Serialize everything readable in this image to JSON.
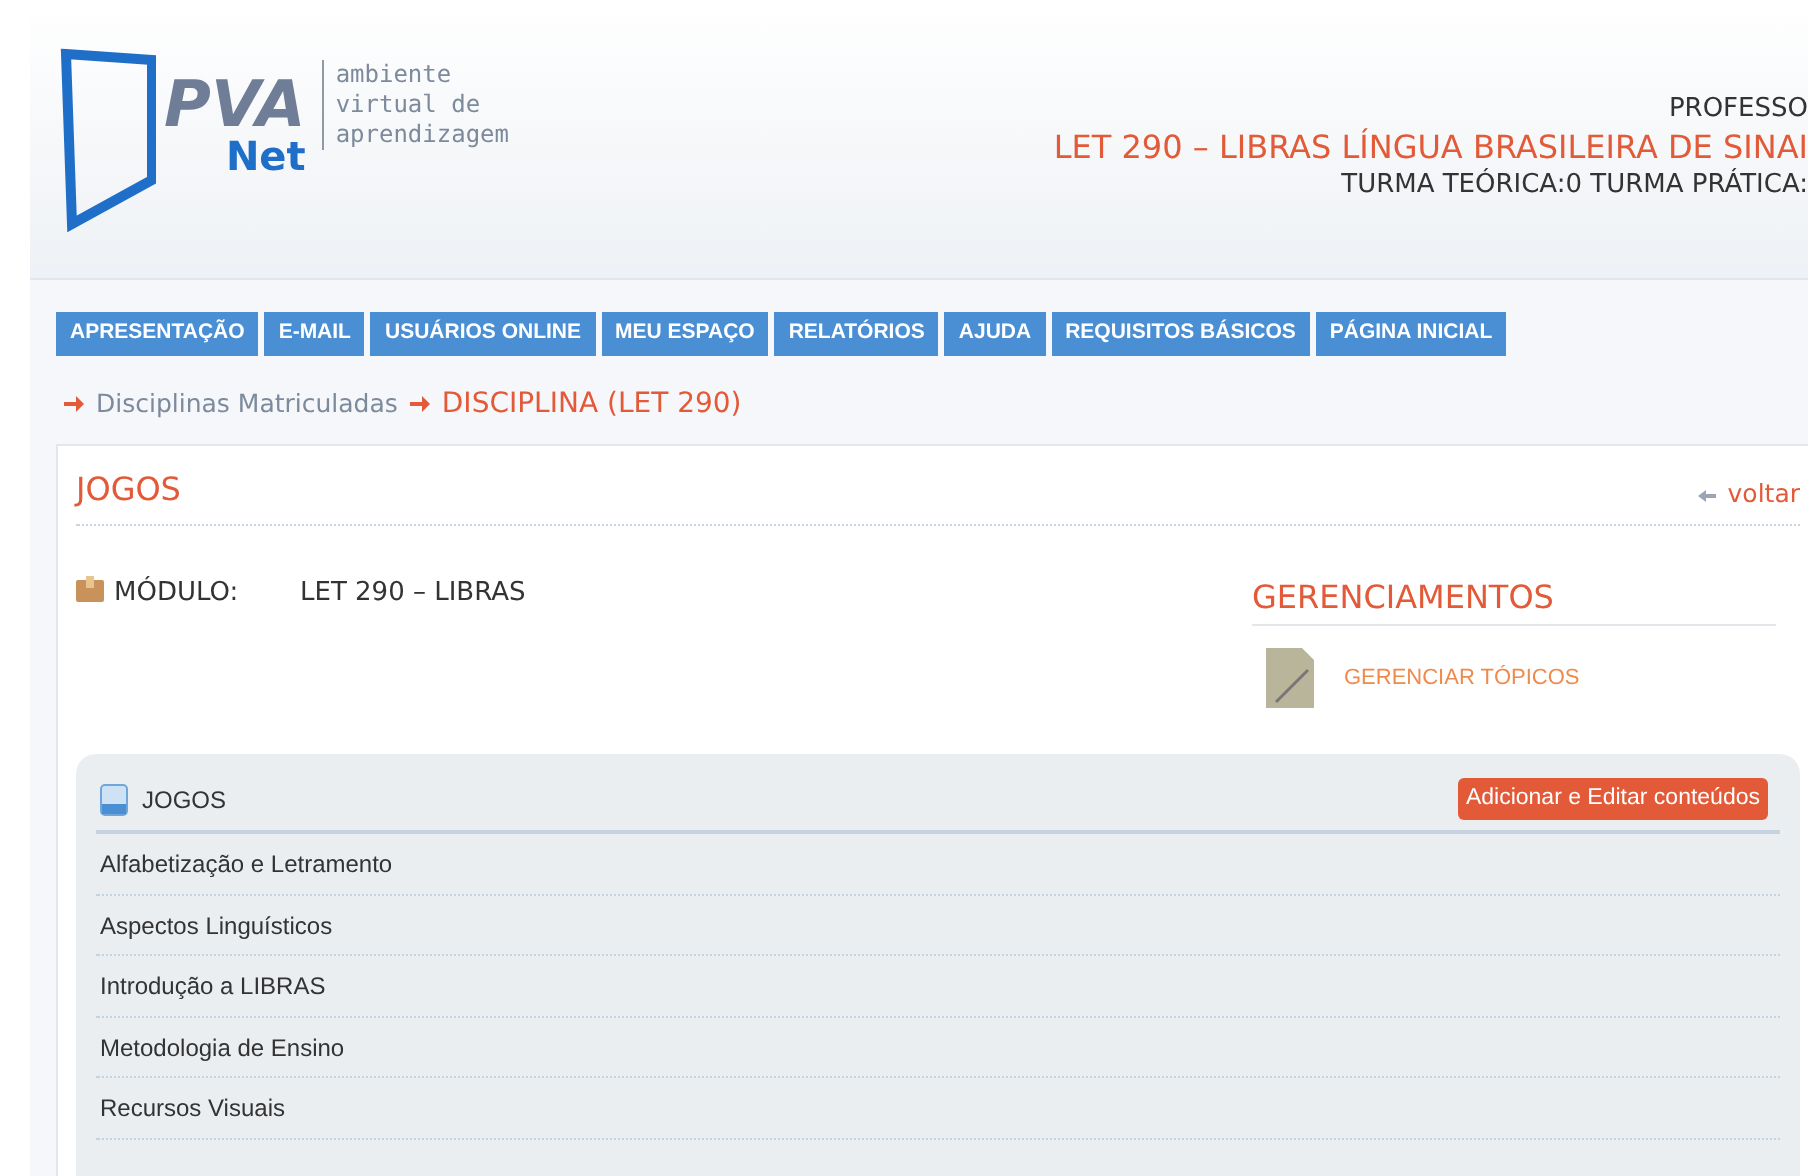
{
  "logo": {
    "mark": "PVA",
    "sub": "Net",
    "tagline": [
      "ambiente",
      "virtual de",
      "aprendizagem"
    ]
  },
  "header": {
    "role": "PROFESSO",
    "course": "LET 290 – LIBRAS LÍNGUA BRASILEIRA DE SINAI",
    "classes": "TURMA TEÓRICA:0 TURMA PRÁTICA:"
  },
  "nav": [
    "APRESENTAÇÃO",
    "E-MAIL",
    "USUÁRIOS ONLINE",
    "MEU ESPAÇO",
    "RELATÓRIOS",
    "AJUDA",
    "REQUISITOS BÁSICOS",
    "PÁGINA INICIAL"
  ],
  "breadcrumb": [
    {
      "label": "Disciplinas Matriculadas",
      "current": false
    },
    {
      "label": "DISCIPLINA (LET 290)",
      "current": true
    }
  ],
  "page": {
    "title": "JOGOS",
    "back": "voltar"
  },
  "module": {
    "label": "MÓDULO:",
    "value": "LET 290 – LIBRAS"
  },
  "management": {
    "title": "GERENCIAMENTOS",
    "links": [
      "GERENCIAR TÓPICOS"
    ]
  },
  "topics": {
    "title": "JOGOS",
    "action": "Adicionar e Editar conteúdos",
    "items": [
      "Alfabetização e Letramento",
      "Aspectos Linguísticos",
      "Introdução a LIBRAS",
      "Metodologia de Ensino",
      "Recursos Visuais"
    ]
  }
}
